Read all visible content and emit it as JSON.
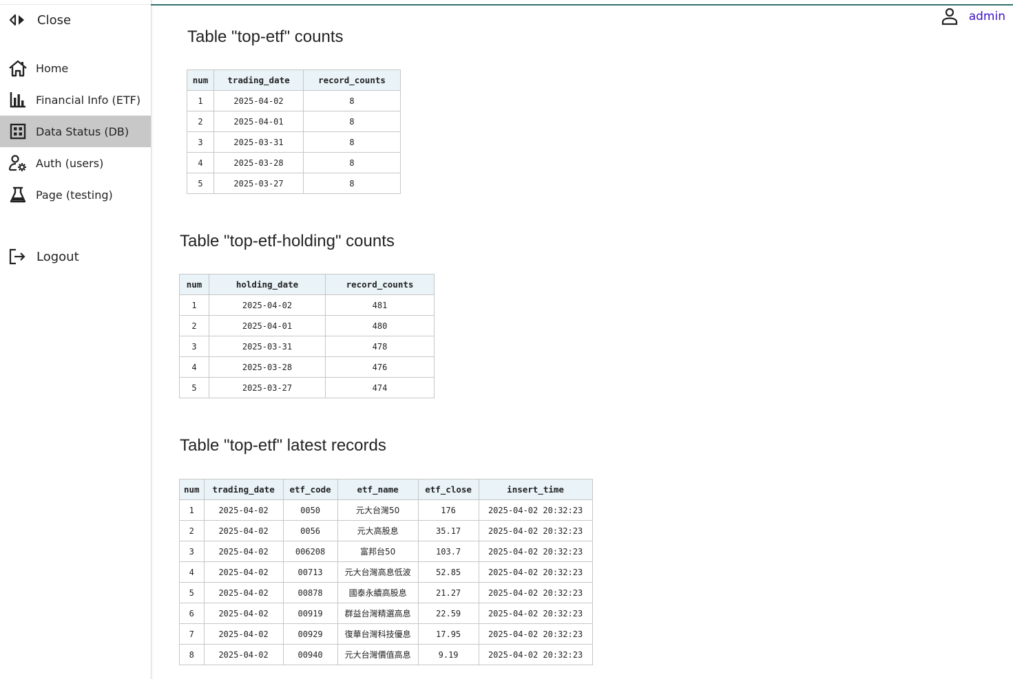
{
  "sidebar": {
    "close_label": "Close",
    "items": [
      {
        "label": "Home",
        "icon": "home-icon",
        "active": false
      },
      {
        "label": "Financial Info (ETF)",
        "icon": "bar-chart-icon",
        "active": false
      },
      {
        "label": "Data Status (DB)",
        "icon": "grid-icon",
        "active": true
      },
      {
        "label": "Auth (users)",
        "icon": "user-gear-icon",
        "active": false
      },
      {
        "label": "Page (testing)",
        "icon": "flask-icon",
        "active": false
      }
    ],
    "logout_label": "Logout"
  },
  "header": {
    "user_name": "admin"
  },
  "colors": {
    "accent_line": "#2e6f6a",
    "user_link": "#3b12c9",
    "active_nav_bg": "#c8c8c8",
    "table_header_bg": "#e9f3f8"
  },
  "tables": {
    "top_etf_counts": {
      "title": "Table \"top-etf\" counts",
      "columns": [
        "num",
        "trading_date",
        "record_counts"
      ],
      "rows": [
        [
          "1",
          "2025-04-02",
          "8"
        ],
        [
          "2",
          "2025-04-01",
          "8"
        ],
        [
          "3",
          "2025-03-31",
          "8"
        ],
        [
          "4",
          "2025-03-28",
          "8"
        ],
        [
          "5",
          "2025-03-27",
          "8"
        ]
      ]
    },
    "top_etf_holding_counts": {
      "title": "Table \"top-etf-holding\" counts",
      "columns": [
        "num",
        "holding_date",
        "record_counts"
      ],
      "rows": [
        [
          "1",
          "2025-04-02",
          "481"
        ],
        [
          "2",
          "2025-04-01",
          "480"
        ],
        [
          "3",
          "2025-03-31",
          "478"
        ],
        [
          "4",
          "2025-03-28",
          "476"
        ],
        [
          "5",
          "2025-03-27",
          "474"
        ]
      ]
    },
    "top_etf_latest": {
      "title": "Table \"top-etf\" latest records",
      "columns": [
        "num",
        "trading_date",
        "etf_code",
        "etf_name",
        "etf_close",
        "insert_time"
      ],
      "rows": [
        [
          "1",
          "2025-04-02",
          "0050",
          "元大台灣50",
          "176",
          "2025-04-02 20:32:23"
        ],
        [
          "2",
          "2025-04-02",
          "0056",
          "元大高股息",
          "35.17",
          "2025-04-02 20:32:23"
        ],
        [
          "3",
          "2025-04-02",
          "006208",
          "富邦台50",
          "103.7",
          "2025-04-02 20:32:23"
        ],
        [
          "4",
          "2025-04-02",
          "00713",
          "元大台灣高息低波",
          "52.85",
          "2025-04-02 20:32:23"
        ],
        [
          "5",
          "2025-04-02",
          "00878",
          "國泰永續高股息",
          "21.27",
          "2025-04-02 20:32:23"
        ],
        [
          "6",
          "2025-04-02",
          "00919",
          "群益台灣精選高息",
          "22.59",
          "2025-04-02 20:32:23"
        ],
        [
          "7",
          "2025-04-02",
          "00929",
          "復華台灣科技優息",
          "17.95",
          "2025-04-02 20:32:23"
        ],
        [
          "8",
          "2025-04-02",
          "00940",
          "元大台灣價值高息",
          "9.19",
          "2025-04-02 20:32:23"
        ]
      ]
    }
  }
}
